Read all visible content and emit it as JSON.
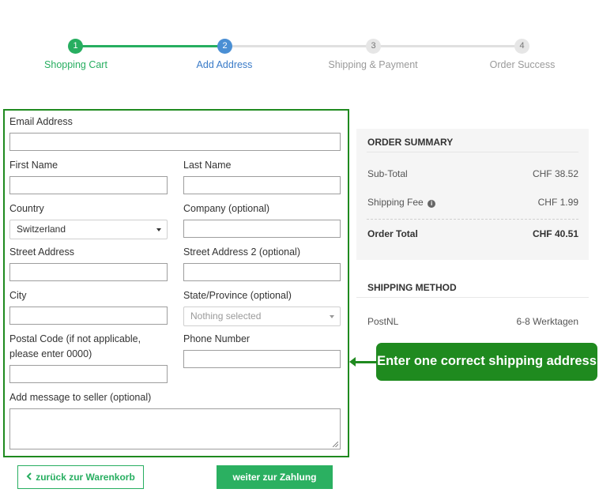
{
  "stepper": {
    "steps": [
      {
        "number": "1",
        "label": "Shopping Cart",
        "state": "done"
      },
      {
        "number": "2",
        "label": "Add Address",
        "state": "active"
      },
      {
        "number": "3",
        "label": "Shipping & Payment",
        "state": "todo"
      },
      {
        "number": "4",
        "label": "Order Success",
        "state": "todo"
      }
    ],
    "colors": {
      "done": "#27ae60",
      "active": "#4a8fd4",
      "todo": "#e6e6e6"
    }
  },
  "form": {
    "email_label": "Email Address",
    "email_value": "",
    "first_name_label": "First Name",
    "first_name_value": "",
    "last_name_label": "Last Name",
    "last_name_value": "",
    "country_label": "Country",
    "country_value": "Switzerland",
    "company_label": "Company (optional)",
    "company_value": "",
    "street_label": "Street Address",
    "street_value": "",
    "street2_label": "Street Address 2 (optional)",
    "street2_value": "",
    "city_label": "City",
    "city_value": "",
    "state_label": "State/Province (optional)",
    "state_value": "Nothing selected",
    "postal_label": "Postal Code (if not applicable, please enter 0000)",
    "postal_value": "",
    "phone_label": "Phone Number",
    "phone_value": "",
    "message_label": "Add message to seller (optional)",
    "message_value": ""
  },
  "buttons": {
    "back_label": "zurück zur Warenkorb",
    "back_icon": "chevron-left-icon",
    "next_label": "weiter zur Zahlung"
  },
  "summary": {
    "title": "ORDER SUMMARY",
    "subtotal_label": "Sub-Total",
    "subtotal_value": "CHF 38.52",
    "shipping_label": "Shipping Fee",
    "shipping_value": "CHF 1.99",
    "shipping_icon": "info-icon",
    "total_label": "Order Total",
    "total_value": "CHF 40.51"
  },
  "shipping_method": {
    "title": "SHIPPING METHOD",
    "carrier": "PostNL",
    "duration": "6-8 Werktagen"
  },
  "annotation": {
    "text": "Enter one correct shipping address",
    "color": "#1f8a1f"
  }
}
